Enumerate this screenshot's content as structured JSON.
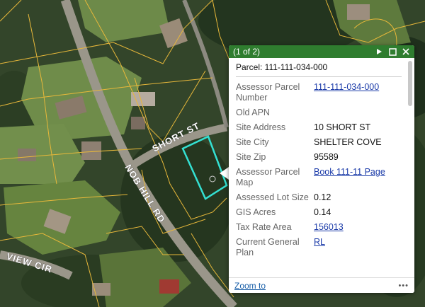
{
  "map": {
    "road_labels": {
      "short_st": "SHORT ST",
      "nob_hill_rd": "NOB HILL RD",
      "view_cir": "VIEW CIR"
    },
    "parcel_line_color": "#e8b83a",
    "selected_parcel_color": "#34e0d2"
  },
  "popup": {
    "counter": "(1 of 2)",
    "header_color": "#2f7d2f",
    "heading": "Parcel: 111-111-034-000",
    "rows": [
      {
        "key": "Assessor Parcel Number",
        "value": "111-111-034-000",
        "link": true
      },
      {
        "key": "Old APN",
        "value": "",
        "link": false
      },
      {
        "key": "Site Address",
        "value": "10 SHORT ST",
        "link": false
      },
      {
        "key": "Site City",
        "value": "SHELTER COVE",
        "link": false
      },
      {
        "key": "Site Zip",
        "value": "95589",
        "link": false
      },
      {
        "key": "Assessor Parcel Map",
        "value": "Book 111-11 Page",
        "link": true
      },
      {
        "key": "Assessed Lot Size",
        "value": "0.12",
        "link": false
      },
      {
        "key": "GIS Acres",
        "value": "0.14",
        "link": false
      },
      {
        "key": "Tax Rate Area",
        "value": "156013",
        "link": true
      },
      {
        "key": "Current General Plan",
        "value": "RL",
        "link": true
      }
    ],
    "zoom_to": "Zoom to",
    "more": "•••",
    "icons": [
      "play-icon",
      "maximize-icon",
      "close-icon"
    ]
  }
}
